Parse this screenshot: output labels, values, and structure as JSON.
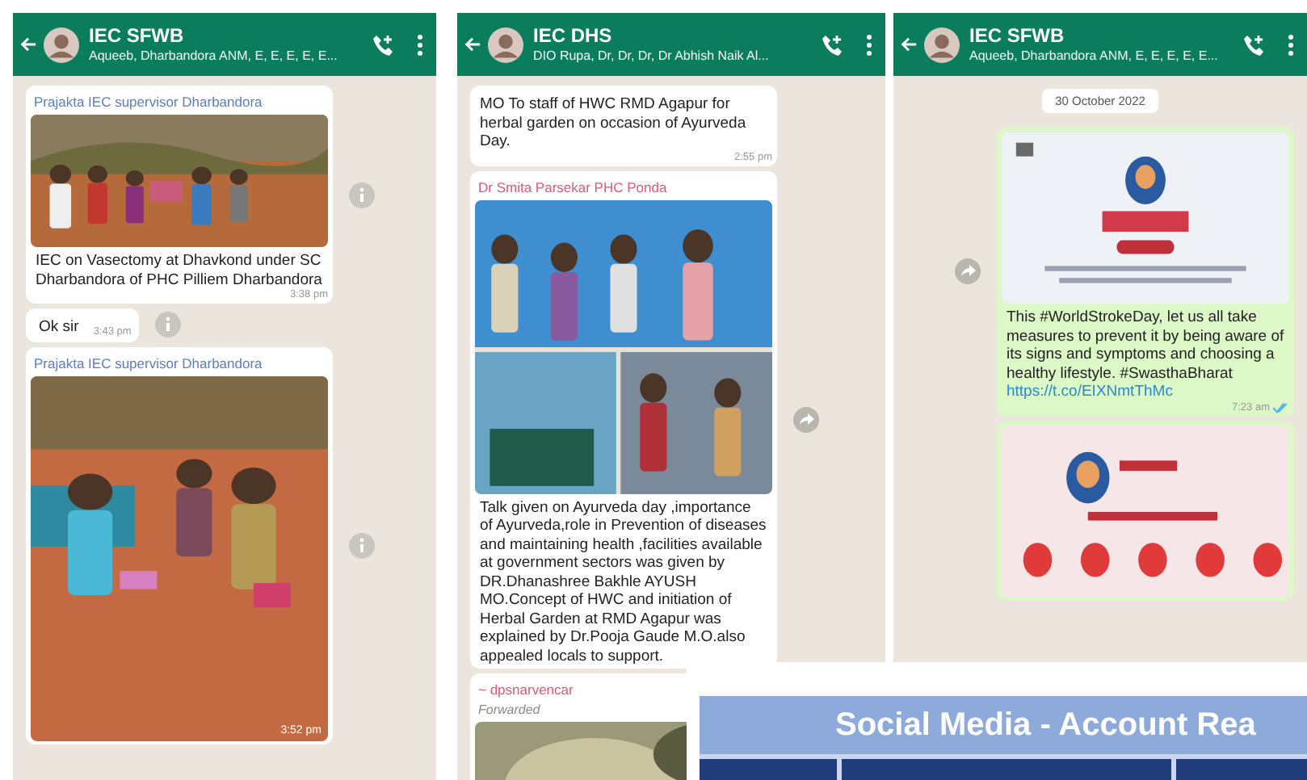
{
  "panels": [
    {
      "header": {
        "title": "IEC SFWB",
        "subtitle": "Aqueeb, Dharbandora ANM, E, E, E, E, E..."
      },
      "messages": [
        {
          "kind": "media",
          "outgoing": false,
          "sender": "Prajakta IEC supervisor Dharbandora",
          "caption": "IEC on Vasectomy at Dhavkond under SC Dharbandora of PHC Pilliem Dharbandora",
          "time": "3:38 pm",
          "side_button": {
            "kind": "info"
          }
        },
        {
          "kind": "text",
          "outgoing": false,
          "text": "Ok sir",
          "time": "3:43 pm",
          "side_button": {
            "kind": "info"
          }
        },
        {
          "kind": "media",
          "outgoing": false,
          "sender": "Prajakta IEC supervisor Dharbandora",
          "time": "3:52 pm",
          "side_button": {
            "kind": "info"
          }
        }
      ]
    },
    {
      "header": {
        "title": "IEC DHS",
        "subtitle": "DIO Rupa, Dr, Dr, Dr, Dr Abhish Naik Al..."
      },
      "messages": [
        {
          "kind": "text",
          "outgoing": false,
          "text": "MO To staff of HWC RMD Agapur for herbal garden on occasion of Ayurveda Day.",
          "time": "2:55 pm"
        },
        {
          "kind": "media",
          "outgoing": false,
          "sender": "Dr Smita Parsekar PHC Ponda",
          "caption": "Talk given on Ayurveda day ,importance of Ayurveda,role in Prevention of diseases and maintaining health ,facilities available at government sectors was given by DR.Dhanashree Bakhle AYUSH MO.Concept of HWC and initiation of Herbal Garden at RMD Agapur was explained by Dr.Pooja Gaude M.O.also appealed locals to support.",
          "side_button": {
            "kind": "forward"
          }
        },
        {
          "kind": "media",
          "outgoing": false,
          "sender": "~ dpsnarvencar",
          "forwarded": "Forwarded"
        }
      ]
    },
    {
      "header": {
        "title": "IEC SFWB",
        "subtitle": "Aqueeb, Dharbandora ANM, E, E, E, E, E..."
      },
      "messages": [
        {
          "kind": "date",
          "text": "30 October 2022"
        },
        {
          "kind": "media",
          "outgoing": true,
          "caption": "This #WorldStrokeDay, let us all take measures to prevent it by being aware of its signs and symptoms and choosing a healthy lifestyle. #SwasthaBharat",
          "link": "https://t.co/EIXNmtThMc",
          "time": "7:23 am",
          "read": true,
          "side_button": {
            "kind": "forward"
          }
        },
        {
          "kind": "media",
          "outgoing": true
        }
      ]
    }
  ],
  "table": {
    "title": "Social Media - Account Rea"
  }
}
